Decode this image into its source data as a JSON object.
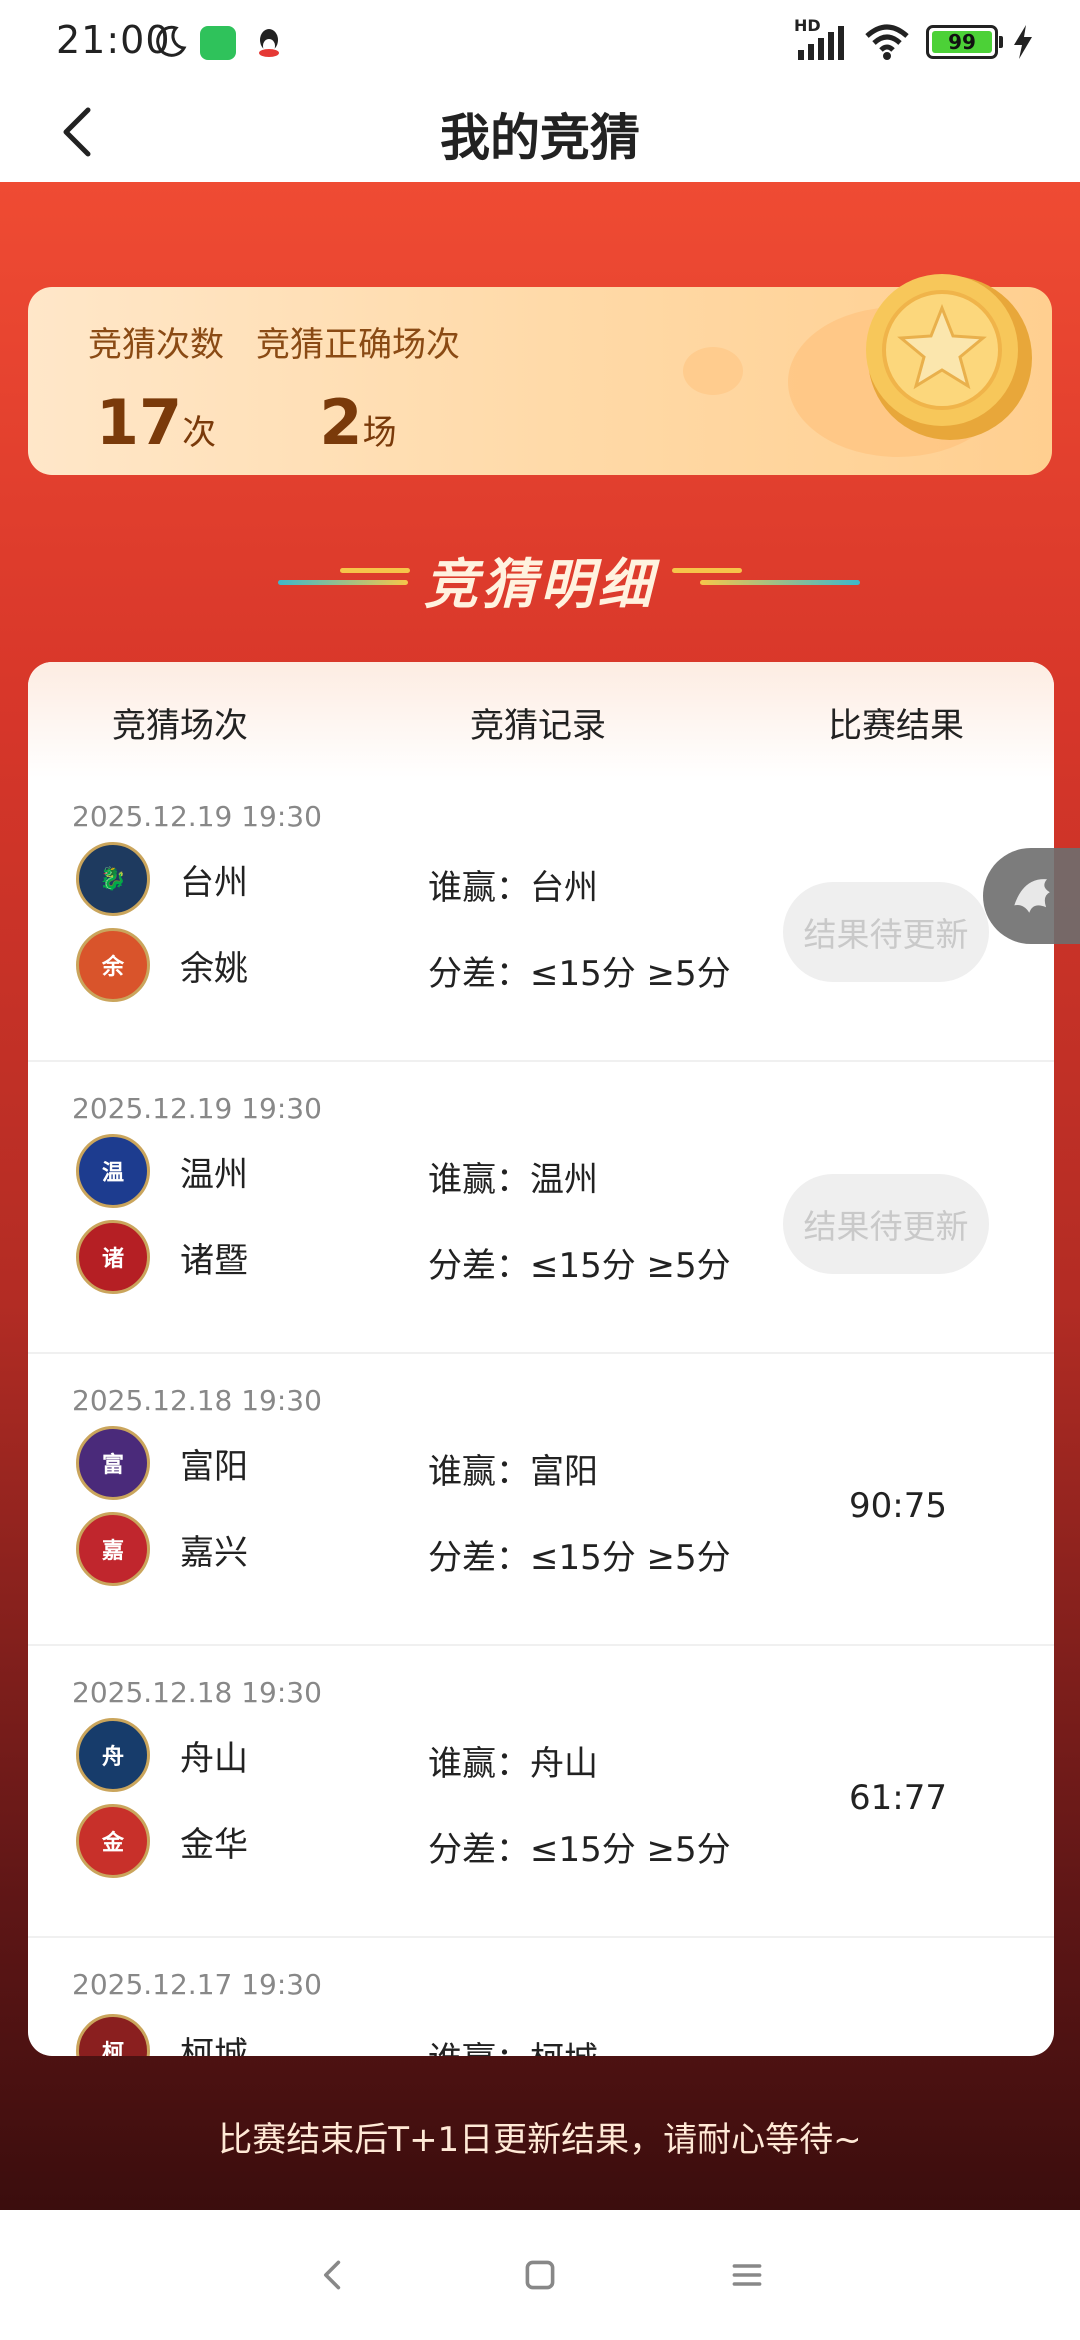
{
  "status": {
    "time": "21:00",
    "network": "HD",
    "battery": "99"
  },
  "header": {
    "title": "我的竞猜"
  },
  "summary": {
    "count_label": "竞猜次数",
    "count_value": "17",
    "count_unit": "次",
    "correct_label": "竞猜正确场次",
    "correct_value": "2",
    "correct_unit": "场"
  },
  "section": {
    "title": "竞猜明细"
  },
  "table": {
    "headers": [
      "竞猜场次",
      "竞猜记录",
      "比赛结果"
    ],
    "rows": [
      {
        "date": "2025.12.19 19:30",
        "team1": "台州",
        "team2": "余姚",
        "winner": "谁赢：台州",
        "margin": "分差：≤15分 ≥5分",
        "result": "结果待更新"
      },
      {
        "date": "2025.12.19 19:30",
        "team1": "温州",
        "team2": "诸暨",
        "winner": "谁赢：温州",
        "margin": "分差：≤15分 ≥5分",
        "result": "结果待更新"
      },
      {
        "date": "2025.12.18 19:30",
        "team1": "富阳",
        "team2": "嘉兴",
        "winner": "谁赢：富阳",
        "margin": "分差：≤15分 ≥5分",
        "result": "90:75"
      },
      {
        "date": "2025.12.18 19:30",
        "team1": "舟山",
        "team2": "金华",
        "winner": "谁赢：舟山",
        "margin": "分差：≤15分 ≥5分",
        "result": "61:77"
      },
      {
        "date": "2025.12.17 19:30",
        "team1": "柯城",
        "team2": "",
        "winner": "谁赢：柯城",
        "margin": "",
        "result": ""
      }
    ]
  },
  "footer": {
    "note": "比赛结束后T+1日更新结果，请耐心等待~"
  },
  "colors": {
    "primary_red": "#d8372a",
    "gold": "#f4b64a",
    "pending_bg": "#efefef",
    "pending_text": "#c9c9c9"
  }
}
